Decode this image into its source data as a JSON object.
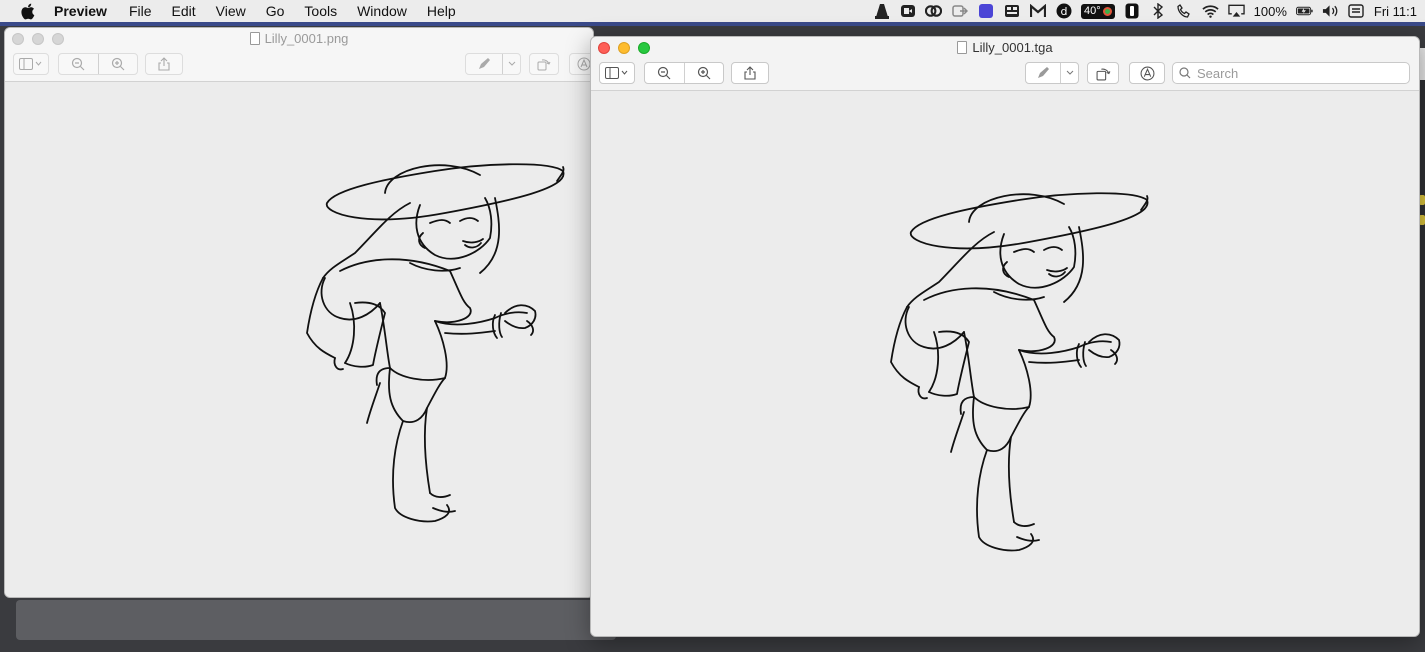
{
  "menubar": {
    "app_name": "Preview",
    "items": [
      "File",
      "Edit",
      "View",
      "Go",
      "Tools",
      "Window",
      "Help"
    ],
    "status": {
      "temperature": "40°",
      "battery": "100%",
      "clock": "Fri 11:1"
    }
  },
  "windows": {
    "back": {
      "title": "Lilly_0001.png"
    },
    "front": {
      "title": "Lilly_0001.tga",
      "search_placeholder": "Search"
    }
  },
  "icons": {
    "sidebar": "sidebar-icon",
    "zoom_out": "zoom-out-icon",
    "zoom_in": "zoom-in-icon",
    "share": "share-icon",
    "markup": "markup-pen-icon",
    "rotate": "rotate-icon",
    "annotate": "annotate-circle-icon",
    "search": "magnifier-icon"
  },
  "colors": {
    "close": "#fe5f57",
    "minimize": "#febc2e",
    "zoom": "#28c840"
  }
}
